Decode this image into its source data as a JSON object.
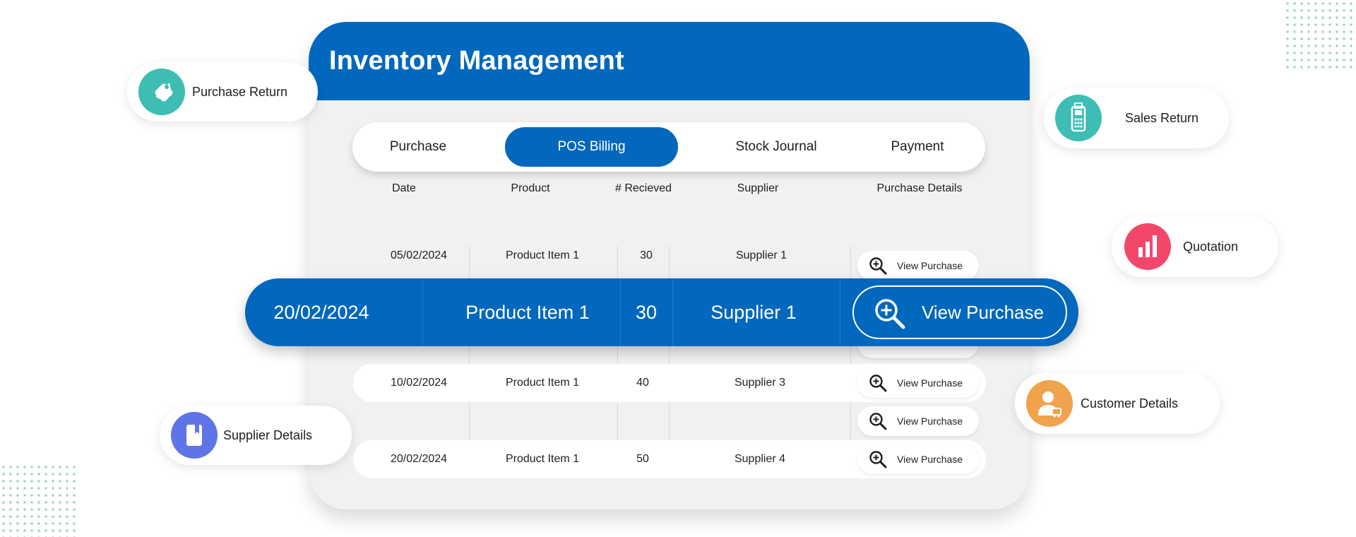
{
  "colors": {
    "brand_blue": "#0268bd",
    "card_bg": "#f1f1f1",
    "teal": "#3dbdb4",
    "pink": "#f2476b",
    "orange": "#f0a24c",
    "indigo": "#5f74e6"
  },
  "card": {
    "title": "Inventory Management"
  },
  "tabs": [
    {
      "label": "Purchase",
      "active": false
    },
    {
      "label": "POS Billing",
      "active": true
    },
    {
      "label": "Stock Journal",
      "active": false
    },
    {
      "label": "Payment",
      "active": false
    }
  ],
  "table": {
    "headers": [
      "Date",
      "Product",
      "# Recieved",
      "Supplier",
      "Purchase Details"
    ],
    "rows": [
      {
        "date": "05/02/2024",
        "product": "Product Item 1",
        "received": "30",
        "supplier": "Supplier 1",
        "action": "View Purchase"
      },
      {
        "date": "10/02/2024",
        "product": "Product Item 1",
        "received": "40",
        "supplier": "Supplier 3",
        "action": "View Purchase"
      },
      {
        "date": "",
        "product": "",
        "received": "",
        "supplier": "",
        "action": "View Purchase"
      },
      {
        "date": "20/02/2024",
        "product": "Product Item 1",
        "received": "50",
        "supplier": "Supplier 4",
        "action": "View Purchase"
      }
    ],
    "highlighted_row": {
      "date": "20/02/2024",
      "product": "Product Item 1",
      "received": "30",
      "supplier": "Supplier 1",
      "action": "View Purchase"
    }
  },
  "pills": {
    "purchase_return": {
      "label": "Purchase Return",
      "icon": "tag-icon"
    },
    "sales_return": {
      "label": "Sales Return",
      "icon": "card-reader-icon"
    },
    "quotation": {
      "label": "Quotation",
      "icon": "bar-chart-icon"
    },
    "customer_details": {
      "label": "Customer Details",
      "icon": "customer-icon"
    },
    "supplier_details": {
      "label": "Supplier Details",
      "icon": "book-icon"
    }
  }
}
